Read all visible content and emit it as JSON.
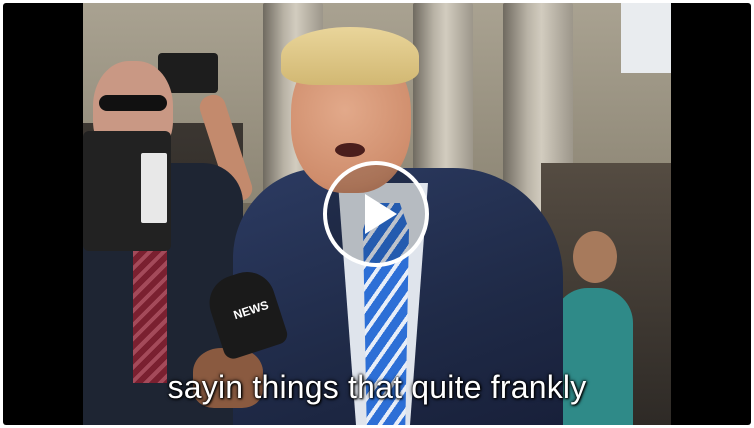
{
  "player": {
    "caption": "sayin things that quite frankly",
    "play_icon": "play-icon",
    "mic_logo": "NEWS"
  },
  "colors": {
    "letterbox": "#000000",
    "caption_text": "#ffffff",
    "play_ring": "#ffffff"
  }
}
